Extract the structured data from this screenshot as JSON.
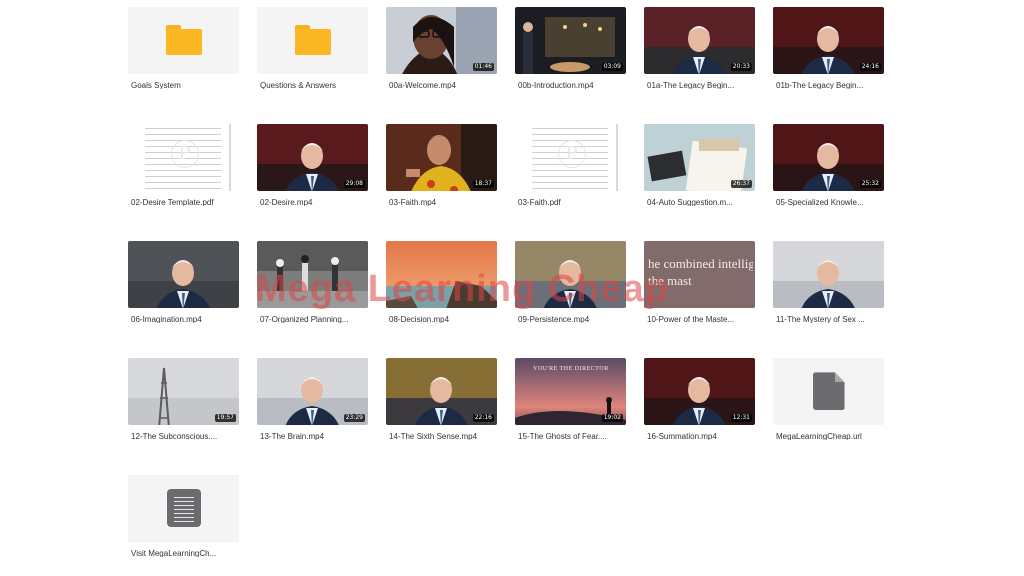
{
  "watermark": "Mega Learning Cheap",
  "items": [
    {
      "name": "Goals System",
      "kind": "folder"
    },
    {
      "name": "Questions & Answers",
      "kind": "folder"
    },
    {
      "name": "00a-Welcome.mp4",
      "kind": "video",
      "duration": "01:46",
      "thumb": "woman-glasses"
    },
    {
      "name": "00b-Introduction.mp4",
      "kind": "video",
      "duration": "03:09",
      "thumb": "stage"
    },
    {
      "name": "01a-The Legacy Begin...",
      "kind": "video",
      "duration": "20:33",
      "thumb": "speaker-theater"
    },
    {
      "name": "01b-The Legacy Begin...",
      "kind": "video",
      "duration": "24:16",
      "thumb": "speaker-red"
    },
    {
      "name": "02-Desire Template.pdf",
      "kind": "pdf"
    },
    {
      "name": "02-Desire.mp4",
      "kind": "video",
      "duration": "29:08",
      "thumb": "speaker-gesture"
    },
    {
      "name": "03-Faith.mp4",
      "kind": "video",
      "duration": "18:37",
      "thumb": "woman-yellow"
    },
    {
      "name": "03-Faith.pdf",
      "kind": "pdf"
    },
    {
      "name": "04-Auto Suggestion.m...",
      "kind": "video",
      "duration": "26:37",
      "thumb": "desk"
    },
    {
      "name": "05-Specialized Knowle...",
      "kind": "video",
      "duration": "25:32",
      "thumb": "speaker-red"
    },
    {
      "name": "06-Imagination.mp4",
      "kind": "video",
      "duration": "",
      "thumb": "speaker-grey"
    },
    {
      "name": "07-Organized Planning...",
      "kind": "video",
      "duration": "",
      "thumb": "football"
    },
    {
      "name": "08-Decision.mp4",
      "kind": "video",
      "duration": "",
      "thumb": "sunset-coast"
    },
    {
      "name": "09-Persistence.mp4",
      "kind": "video",
      "duration": "",
      "thumb": "speaker-chair"
    },
    {
      "name": "10-Power of the Maste...",
      "kind": "video",
      "duration": "",
      "thumb": "slide",
      "slide_text": "he combined intellig\nthe mast"
    },
    {
      "name": "11-The Mystery of Sex ...",
      "kind": "video",
      "duration": "",
      "thumb": "speaker-window"
    },
    {
      "name": "12-The Subconscious....",
      "kind": "video",
      "duration": "19:57",
      "thumb": "tower"
    },
    {
      "name": "13-The Brain.mp4",
      "kind": "video",
      "duration": "23:29",
      "thumb": "speaker-window"
    },
    {
      "name": "14-The Sixth Sense.mp4",
      "kind": "video",
      "duration": "22:16",
      "thumb": "speaker-throne"
    },
    {
      "name": "15-The Ghosts of Fear....",
      "kind": "video",
      "duration": "19:02",
      "thumb": "sunset-person",
      "slide_text": "YOU'RE THE DIRECTOR"
    },
    {
      "name": "16-Summation.mp4",
      "kind": "video",
      "duration": "12:31",
      "thumb": "speaker-red"
    },
    {
      "name": "MegaLearningCheap.url",
      "kind": "url"
    },
    {
      "name": "Visit MegaLearningCh...",
      "kind": "doc"
    }
  ]
}
